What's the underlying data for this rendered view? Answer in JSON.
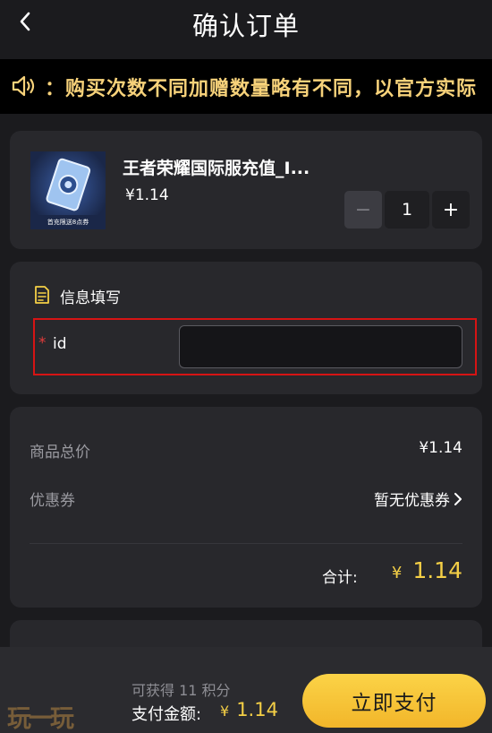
{
  "header": {
    "title": "确认订单"
  },
  "notice": {
    "text": "：购买次数不同加赠数量略有不同，以官方实际"
  },
  "product": {
    "name": "王者荣耀国际服充值_I...",
    "price": "¥1.14",
    "thumb_caption": "首充限送8点券",
    "quantity": "1",
    "minus_label": "−",
    "plus_label": "+"
  },
  "info": {
    "section_title": "信息填写",
    "required_mark": "*",
    "id_label": "id",
    "id_value": ""
  },
  "summary": {
    "subtotal_label": "商品总价",
    "subtotal_value": "¥1.14",
    "coupon_label": "优惠券",
    "coupon_value": "暂无优惠券",
    "total_label": "合计:",
    "total_currency": "¥",
    "total_amount": "1.14"
  },
  "bottom": {
    "logo_text": "玩一玩",
    "points_text": "可获得 11 积分",
    "pay_label": "支付金额:",
    "pay_currency": "¥",
    "pay_amount": "1.14",
    "pay_button": "立即支付"
  },
  "colors": {
    "accent": "#f4cf46",
    "notice_text": "#f7d27a",
    "highlight_border": "#d61414",
    "background": "#1b1b1e",
    "card": "#28282c"
  }
}
